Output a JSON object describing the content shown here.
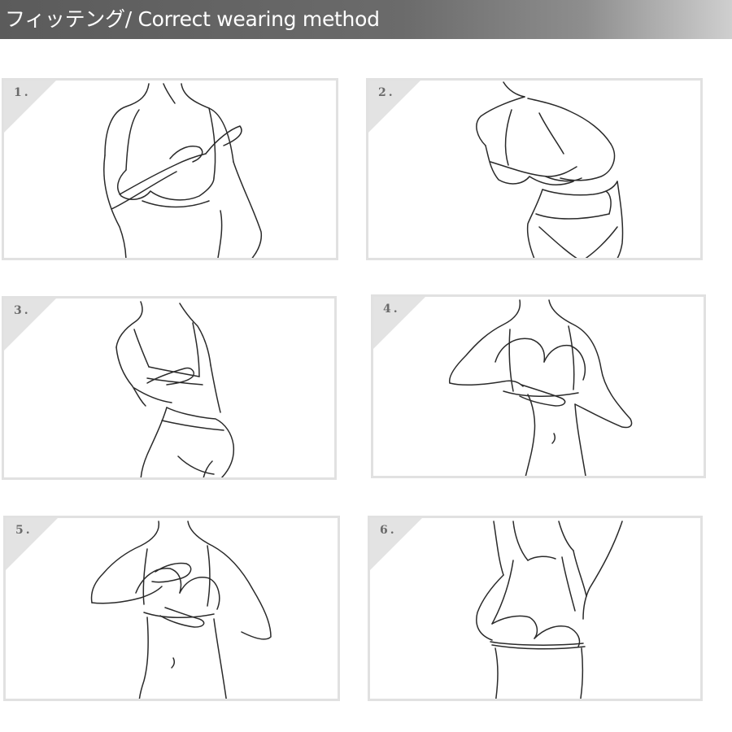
{
  "header": {
    "title": "フィッテング/ Correct wearing method"
  },
  "steps": [
    {
      "number": "1."
    },
    {
      "number": "2."
    },
    {
      "number": "3."
    },
    {
      "number": "4."
    },
    {
      "number": "5."
    },
    {
      "number": "6."
    }
  ],
  "colors": {
    "header_bg": "#5b5b5b",
    "panel_border": "#e1e1e1",
    "line_art": "#2a2a2a"
  }
}
